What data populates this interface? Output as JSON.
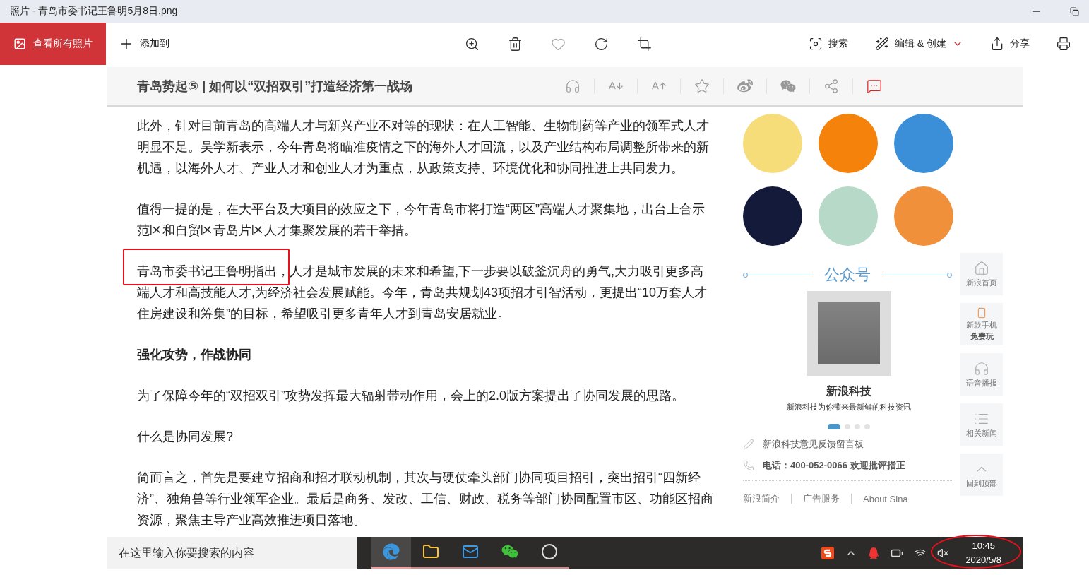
{
  "window": {
    "title": "照片 - 青岛市委书记王鲁明5月8日.png"
  },
  "toolbar": {
    "all_photos": "查看所有照片",
    "add_to": "添加到",
    "tools": [
      {
        "kind": "zoom"
      },
      {
        "kind": "delete"
      },
      {
        "kind": "favorite"
      },
      {
        "kind": "rotate"
      },
      {
        "kind": "crop"
      }
    ],
    "actions": [
      {
        "kind": "search",
        "label": "搜索"
      },
      {
        "kind": "edit",
        "label": "编辑 & 创建"
      },
      {
        "kind": "share",
        "label": "分享"
      },
      {
        "kind": "print"
      }
    ]
  },
  "image": {
    "header": {
      "title": "青岛势起⑤ | 如何以“双招双引”打造经济第一战场",
      "tools": [
        {
          "kind": "audio"
        },
        {
          "kind": "font_smaller"
        },
        {
          "kind": "font_larger"
        },
        {
          "kind": "star"
        },
        {
          "kind": "weibo"
        },
        {
          "kind": "wechat"
        },
        {
          "kind": "share"
        },
        {
          "kind": "comment"
        }
      ]
    },
    "article": [
      {
        "kind": "paragraph",
        "text": "此外，针对目前青岛的高端人才与新兴产业不对等的现状：在人工智能、生物制药等产业的领军式人才明显不足。吴学新表示，今年青岛将瞄准疫情之下的海外人才回流，以及产业结构布局调整所带来的新机遇，以海外人才、产业人才和创业人才为重点，从政策支持、环境优化和协同推进上共同发力。",
        "annotated": false
      },
      {
        "kind": "paragraph",
        "text": "值得一提的是，在大平台及大项目的效应之下，今年青岛市将打造“两区”高端人才聚集地，出台上合示范区和自贸区青岛片区人才集聚发展的若干举措。",
        "annotated": false
      },
      {
        "kind": "paragraph",
        "text": "青岛市委书记王鲁明指出，人才是城市发展的未来和希望,下一步要以破釜沉舟的勇气,大力吸引更多高端人才和高技能人才,为经济社会发展赋能。今年，青岛共规划43项招才引智活动，更提出“10万套人才住房建设和筹集”的目标，希望吸引更多青年人才到青岛安居就业。",
        "annotated": true
      },
      {
        "kind": "heading",
        "text": "强化攻势，作战协同"
      },
      {
        "kind": "paragraph",
        "text": "为了保障今年的“双招双引”攻势发挥最大辐射带动作用，会上的2.0版方案提出了协同发展的思路。",
        "annotated": false
      },
      {
        "kind": "paragraph",
        "text": "什么是协同发展?",
        "annotated": false
      },
      {
        "kind": "paragraph",
        "text": "简而言之，首先是要建立招商和招才联动机制，其次与硬仗牵头部门协同项目招引，突出招引“四新经济”、独角兽等行业领军企业。最后是商务、发改、工信、财政、税务等部门协同配置市区、功能区招商资源，聚焦主导产业高效推进项目落地。",
        "annotated": false
      }
    ],
    "sidebar": {
      "logos": [
        {
          "color": "#f7dc7a"
        },
        {
          "color": "#f5820a"
        },
        {
          "color": "#3a8fd8"
        },
        {
          "color": "#141a3a"
        },
        {
          "color": "#b6d9c8"
        },
        {
          "color": "#f0903a"
        }
      ],
      "public_account": {
        "title": "公众号",
        "name": "新浪科技",
        "description": "新浪科技为你带来最新鲜的科技资讯",
        "dots": [
          {
            "selected": true
          },
          {
            "selected": false
          },
          {
            "selected": false
          },
          {
            "selected": false
          }
        ]
      },
      "contacts": [
        {
          "kind": "feedback",
          "text": "新浪科技意见反馈留言板"
        },
        {
          "kind": "phone",
          "text": "电话：400-052-0066 欢迎批评指正"
        }
      ],
      "footer_links": [
        "新浪简介",
        "广告服务",
        "About Sina"
      ]
    },
    "float_tools": [
      {
        "kind": "home",
        "label": "新浪首页"
      },
      {
        "kind": "phone",
        "label": "新款手机",
        "sub": "免费玩"
      },
      {
        "kind": "audio",
        "label": "语音播报"
      },
      {
        "kind": "news",
        "label": "相关新闻"
      },
      {
        "kind": "top",
        "label": "回到顶部"
      }
    ],
    "taskbar": {
      "search_placeholder": "在这里输入你要搜索的内容",
      "apps": [
        {
          "kind": "edge",
          "selected": true
        },
        {
          "kind": "folder",
          "selected": false
        },
        {
          "kind": "mail",
          "selected": false
        },
        {
          "kind": "wechat",
          "selected": false
        },
        {
          "kind": "app",
          "selected": false
        }
      ],
      "tray": [
        {
          "kind": "sogou"
        },
        {
          "kind": "chevron"
        },
        {
          "kind": "qq"
        },
        {
          "kind": "battery"
        },
        {
          "kind": "wifi"
        },
        {
          "kind": "mute"
        }
      ],
      "time": "10:45",
      "date": "2020/5/8",
      "clock_annotated": true
    }
  }
}
